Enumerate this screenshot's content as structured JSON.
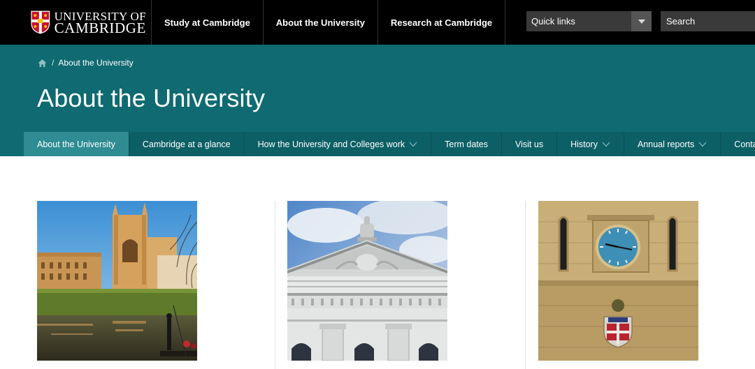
{
  "header": {
    "logo_line1": "UNIVERSITY OF",
    "logo_line2": "CAMBRIDGE",
    "nav": [
      {
        "label": "Study at Cambridge"
      },
      {
        "label": "About the University"
      },
      {
        "label": "Research at Cambridge"
      }
    ],
    "quick_links": "Quick links",
    "search_placeholder": "Search"
  },
  "hero": {
    "breadcrumb_current": "About the University",
    "title": "About the University",
    "subnav": [
      {
        "label": "About the University",
        "active": true
      },
      {
        "label": "Cambridge at a glance"
      },
      {
        "label": "How the University and Colleges work",
        "dropdown": true
      },
      {
        "label": "Term dates"
      },
      {
        "label": "Visit us"
      },
      {
        "label": "History",
        "dropdown": true
      },
      {
        "label": "Annual reports",
        "dropdown": true
      },
      {
        "label": "Contact us"
      }
    ]
  },
  "cards": [
    {
      "image": "kings-college-river-photo"
    },
    {
      "image": "senate-house-pediment-photo"
    },
    {
      "image": "clock-tower-crest-photo"
    }
  ],
  "colors": {
    "header_bg": "#000000",
    "hero_bg": "#0f6a71",
    "subnav_active": "#2e8c92"
  }
}
